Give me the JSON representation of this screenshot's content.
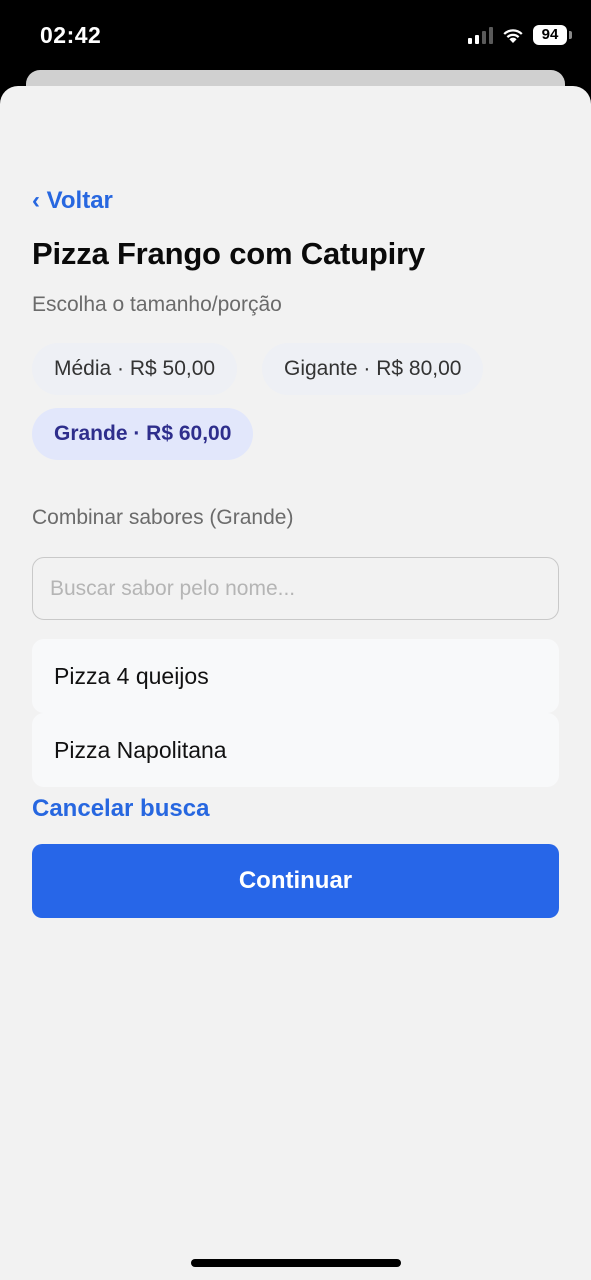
{
  "status_bar": {
    "time": "02:42",
    "battery": "94",
    "icons": [
      "cellular-signal-icon",
      "wifi-icon",
      "battery-icon"
    ]
  },
  "nav": {
    "back_label": "‹ Voltar"
  },
  "product": {
    "title": "Pizza Frango com Catupiry",
    "size_prompt": "Escolha o tamanho/porção"
  },
  "sizes": [
    {
      "label": "Média · R$ 50,00",
      "selected": false
    },
    {
      "label": "Gigante · R$ 80,00",
      "selected": false
    },
    {
      "label": "Grande · R$ 60,00",
      "selected": true
    }
  ],
  "combine": {
    "label": "Combinar sabores (Grande)",
    "search_value": "",
    "search_placeholder": "Buscar sabor pelo nome...",
    "results": [
      {
        "name": "Pizza 4 queijos"
      },
      {
        "name": "Pizza Napolitana"
      }
    ],
    "cancel_label": "Cancelar busca"
  },
  "actions": {
    "continue_label": "Continuar"
  },
  "colors": {
    "accent": "#2767e0",
    "primary_button": "#2766e8",
    "selected_chip_bg": "#e2e7fb",
    "selected_chip_text": "#2e2e8c",
    "sheet_bg": "#f2f2f2"
  }
}
